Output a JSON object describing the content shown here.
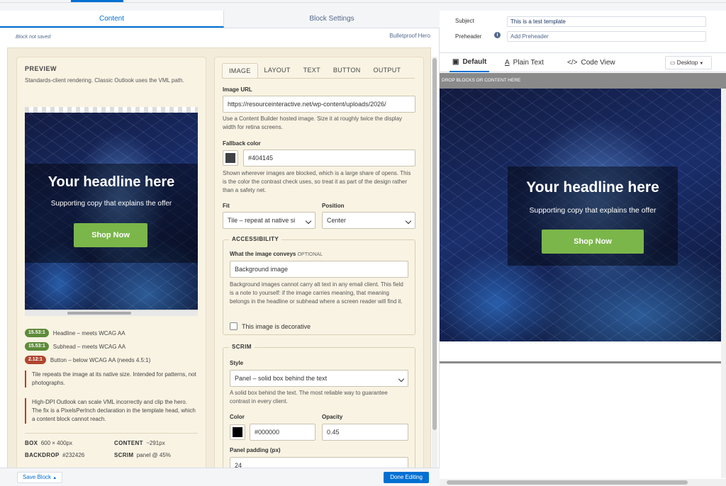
{
  "editor": {
    "tabs": [
      "Content",
      "Block Settings"
    ],
    "status": "Block not saved",
    "block_name": "Bulletproof Hero",
    "footer": {
      "save": "Save Block",
      "done": "Done Editing"
    }
  },
  "preview": {
    "title": "PREVIEW",
    "desc": "Standards-client rendering. Classic Outlook uses the VML path.",
    "headline": "Your headline here",
    "subhead": "Supporting copy that explains the offer",
    "cta": "Shop Now",
    "contrast": [
      {
        "ratio": "15.53:1",
        "label": "Headline – meets WCAG AA",
        "color": "#5e8a3a"
      },
      {
        "ratio": "15.53:1",
        "label": "Subhead – meets WCAG AA",
        "color": "#5e8a3a"
      },
      {
        "ratio": "2.12:1",
        "label": "Button – below WCAG AA (needs 4.5:1)",
        "color": "#b0452f"
      }
    ],
    "notes": [
      "Tile repeats the image at its native size. Intended for patterns, not photographs.",
      "High-DPI Outlook can scale VML incorrectly and clip the hero. The fix is a PixelsPerInch declaration in the template head, which a content block cannot reach."
    ],
    "specs": {
      "box_label": "BOX",
      "box": "600 × 400px",
      "content_label": "CONTENT",
      "content": "~291px",
      "backdrop_label": "BACKDROP",
      "backdrop": "#232426",
      "scrim_label": "SCRIM",
      "scrim": "panel @ 45%"
    }
  },
  "settings": {
    "tabs": [
      "IMAGE",
      "LAYOUT",
      "TEXT",
      "BUTTON",
      "OUTPUT"
    ],
    "image_url_label": "Image URL",
    "image_url": "https://resourceinteractive.net/wp-content/uploads/2026/",
    "image_url_hint": "Use a Content Builder hosted image. Size it at roughly twice the display width for retina screens.",
    "fallback_label": "Fallback color",
    "fallback_value": "#404145",
    "fallback_swatch": "#404145",
    "fallback_hint": "Shown wherever images are blocked, which is a large share of opens. This is the color the contrast check uses, so treat it as part of the design rather than a safety net.",
    "fit_label": "Fit",
    "fit_value": "Tile – repeat at native si",
    "position_label": "Position",
    "position_value": "Center",
    "accessibility": {
      "legend": "ACCESSIBILITY",
      "conveys_label": "What the image conveys",
      "optional": "OPTIONAL",
      "conveys_value": "Background image",
      "hint": "Background images cannot carry alt text in any email client. This field is a note to yourself: if the image carries meaning, that meaning belongs in the headline or subhead where a screen reader will find it.",
      "decorative": "This image is decorative"
    },
    "scrim": {
      "legend": "SCRIM",
      "style_label": "Style",
      "style_value": "Panel – solid box behind the text",
      "style_hint": "A solid box behind the text. The most reliable way to guarantee contrast in every client.",
      "color_label": "Color",
      "color_value": "#000000",
      "color_swatch": "#000000",
      "opacity_label": "Opacity",
      "opacity_value": "0.45",
      "padding_label": "Panel padding (px)",
      "padding_value": "24"
    }
  },
  "email": {
    "subject_label": "Subject",
    "subject_value": "This is a test template",
    "preheader_label": "Preheader",
    "preheader_placeholder": "Add Preheader",
    "views": [
      "Default",
      "Plain Text",
      "Code View"
    ],
    "device": "Desktop",
    "drop_hint": "DROP BLOCKS OR CONTENT HERE",
    "headline": "Your headline here",
    "subhead": "Supporting copy that explains the offer",
    "cta": "Shop Now"
  },
  "icons": [
    "info-icon",
    "default-view-icon",
    "plain-text-icon",
    "code-icon",
    "desktop-icon",
    "caret-down-icon",
    "chevron-down-icon"
  ],
  "colors": {
    "accent": "#0070d2",
    "cta_green": "#7bb64a",
    "panel_bg": "#f9f3e3"
  }
}
